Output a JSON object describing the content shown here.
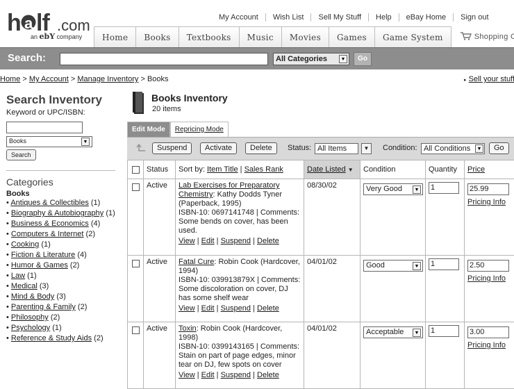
{
  "header": {
    "brand": {
      "name": "half.com",
      "sub_prefix": "an",
      "sub_brand": "ebY",
      "sub_suffix": "company"
    },
    "top_links": [
      "My Account",
      "Wish List",
      "Sell My Stuff",
      "Help",
      "eBay Home",
      "Sign out"
    ],
    "tabs": [
      "Home",
      "Books",
      "Textbooks",
      "Music",
      "Movies",
      "Games",
      "Game System"
    ],
    "cart_label": "Shopping Cart"
  },
  "search": {
    "label": "Search:",
    "value": "",
    "category": "All Categories",
    "go_label": "Go"
  },
  "breadcrumb": {
    "items": [
      "Home",
      "My Account",
      "Manage Inventory",
      "Books"
    ],
    "separator": ">",
    "sell_link": "Sell your stuff"
  },
  "sidebar": {
    "title": "Search Inventory",
    "keyword_label": "Keyword or UPC/ISBN:",
    "keyword_value": "",
    "category_value": "Books",
    "search_button": "Search",
    "categories_heading": "Categories",
    "current": "Books",
    "categories": [
      {
        "name": "Antiques & Collectibles",
        "count": "(1)"
      },
      {
        "name": "Biography & Autobiography",
        "count": "(1)"
      },
      {
        "name": "Business & Economics",
        "count": "(4)"
      },
      {
        "name": "Computers & Internet",
        "count": "(2)"
      },
      {
        "name": "Cooking",
        "count": "(1)"
      },
      {
        "name": "Fiction & Literature",
        "count": "(4)"
      },
      {
        "name": "Humor & Games",
        "count": "(2)"
      },
      {
        "name": "Law",
        "count": "(1)"
      },
      {
        "name": "Medical",
        "count": "(3)"
      },
      {
        "name": "Mind & Body",
        "count": "(3)"
      },
      {
        "name": "Parenting & Family",
        "count": "(2)"
      },
      {
        "name": "Philosophy",
        "count": "(2)"
      },
      {
        "name": "Psychology",
        "count": "(1)"
      },
      {
        "name": "Reference & Study Aids",
        "count": "(2)"
      }
    ]
  },
  "inventory": {
    "title": "Books Inventory",
    "count": "20 items",
    "mode_tabs": [
      "Edit Mode",
      "Repricing Mode"
    ],
    "actions": [
      "Suspend",
      "Activate",
      "Delete"
    ],
    "status_label": "Status:",
    "status_value": "All Items",
    "condition_label": "Condition:",
    "condition_value": "All Conditions",
    "go_label": "Go"
  },
  "table": {
    "headers": {
      "status": "Status",
      "sort_by": "Sort by:",
      "item_title": "Item Title",
      "sep": "|",
      "sales_rank": "Sales Rank",
      "date_listed": "Date Listed",
      "condition": "Condition",
      "quantity": "Quantity",
      "price": "Price"
    },
    "row_actions": {
      "view": "View",
      "edit": "Edit",
      "suspend": "Suspend",
      "delete": "Delete",
      "pricing": "Pricing Info"
    },
    "rows": [
      {
        "status": "Active",
        "title": "Lab Exercises for Preparatory Chemistry",
        "details": ": Kathy Dodds Tyner (Paperback, 1995)",
        "isbn": "ISBN-10: 0697141748 | Comments: Some bends on cover, has been used.",
        "date": "08/30/02",
        "condition": "Very Good",
        "quantity": "1",
        "price": "25.99"
      },
      {
        "status": "Active",
        "title": "Fatal Cure",
        "details": ": Robin Cook (Hardcover, 1994)",
        "isbn": "ISBN-10: 039913879X | Comments: Some discoloration on cover, DJ has some shelf wear",
        "date": "04/01/02",
        "condition": "Good",
        "quantity": "1",
        "price": "2.50"
      },
      {
        "status": "Active",
        "title": "Toxin",
        "details": ": Robin Cook (Hardcover, 1998)",
        "isbn": "ISBN-10: 0399143165 | Comments: Stain on part of page edges, minor tear on DJ, few spots on cover",
        "date": "04/01/02",
        "condition": "Acceptable",
        "quantity": "1",
        "price": "3.00"
      }
    ]
  }
}
